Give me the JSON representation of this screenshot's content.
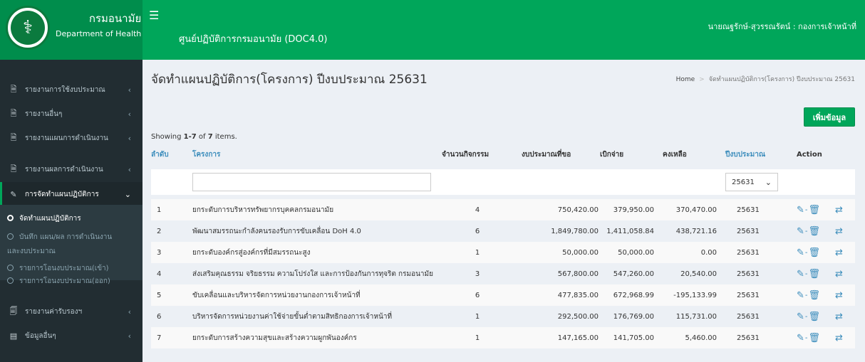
{
  "header": {
    "logo_th": "กรมอนามัย",
    "logo_en": "Department of Health",
    "app_title": "ศูนย์ปฏิบัติการกรมอนามัย (DOC4.0)",
    "user": "นายณฐรักษ์-สุวรรณรัตน์ : กองการเจ้าหน้าที่",
    "menu_icon": "hamburger-icon"
  },
  "sidebar": {
    "items": [
      {
        "label": "รายงานการใช้งบประมาณ",
        "icon": "file-icon"
      },
      {
        "label": "รายงานอื่นๆ",
        "icon": "file-icon"
      },
      {
        "label": "รายงานแผนการดำเนินงาน",
        "icon": "file-icon"
      },
      {
        "label": "รายงานผลการดำเนินงาน",
        "icon": "file-icon"
      },
      {
        "label": "การจัดทำแผนปฏิบัติการ",
        "icon": "edit-icon"
      },
      {
        "label": "รายงานค่ารับรองฯ",
        "icon": "document-icon"
      },
      {
        "label": "ข้อมูลอื่นๆ",
        "icon": "card-icon"
      }
    ],
    "sub_items": [
      {
        "label": "จัดทำแผนปฏิบัติการ"
      },
      {
        "label": "บันทึก แผน/ผล การดำเนินงาน"
      },
      {
        "label": "และงบประมาณ"
      },
      {
        "label": "รายการโอนงบประมาณ(เข้า)"
      },
      {
        "label": "รายการโอนงบประมาณ(ออก)"
      }
    ]
  },
  "main": {
    "title": "จัดทำแผนปฏิบัติการ(โครงการ) ปีงบประมาณ 25631",
    "breadcrumb": {
      "home": "Home",
      "current": "จัดทำแผนปฏิบัติการ(โครงการ) ปีงบประมาณ 25631"
    },
    "add_button": "เพิ่มข้อมูล",
    "summary": {
      "prefix": "Showing ",
      "range": "1-7",
      "of": " of ",
      "total": "7",
      "suffix": " items."
    }
  },
  "table": {
    "headers": [
      "ลำดับ",
      "โครงการ",
      "จำนวนกิจกรรม",
      "งบประมาณที่ขอ",
      "เบิกจ่าย",
      "คงเหลือ",
      "ปีงบประมาณ",
      "Action"
    ],
    "filter": {
      "project_value": "",
      "year_selected": "25631"
    },
    "rows": [
      {
        "no": "1",
        "project": "ยกระดับการบริหารทรัพยากรบุคคลกรมอนามัย",
        "activities": "4",
        "budget": "750,420.00",
        "spent": "379,950.00",
        "remaining": "370,470.00",
        "year": "25631"
      },
      {
        "no": "2",
        "project": "พัฒนาสมรรถนะกำลังคนรองรับการขับเคลื่อน DoH 4.0",
        "activities": "6",
        "budget": "1,849,780.00",
        "spent": "1,411,058.84",
        "remaining": "438,721.16",
        "year": "25631"
      },
      {
        "no": "3",
        "project": "ยกระดับองค์กรสู่องค์กรที่มีสมรรถนะสูง",
        "activities": "1",
        "budget": "50,000.00",
        "spent": "50,000.00",
        "remaining": "0.00",
        "year": "25631"
      },
      {
        "no": "4",
        "project": "ส่งเสริมคุณธรรม จริยธรรม ความโปร่งใส และการป้องกันการทุจริต กรมอนามัย",
        "activities": "3",
        "budget": "567,800.00",
        "spent": "547,260.00",
        "remaining": "20,540.00",
        "year": "25631"
      },
      {
        "no": "5",
        "project": "ขับเคลื่อนและบริหารจัดการหน่วยงานกองการเจ้าหน้าที่",
        "activities": "6",
        "budget": "477,835.00",
        "spent": "672,968.99",
        "remaining": "-195,133.99",
        "year": "25631"
      },
      {
        "no": "6",
        "project": "บริหารจัดการหน่วยงานค่าใช้จ่ายขั้นต่ำตามสิทธิกองการเจ้าหน้าที่",
        "activities": "1",
        "budget": "292,500.00",
        "spent": "176,769.00",
        "remaining": "115,731.00",
        "year": "25631"
      },
      {
        "no": "7",
        "project": "ยกระดับการสร้างความสุขและสร้างความผูกพันองค์กร",
        "activities": "1",
        "budget": "147,165.00",
        "spent": "141,705.00",
        "remaining": "5,460.00",
        "year": "25631"
      }
    ]
  },
  "colors": {
    "brand": "#00a65a",
    "brand_dark": "#008d4c",
    "sidebar": "#222d32",
    "link": "#3c8dbc"
  }
}
